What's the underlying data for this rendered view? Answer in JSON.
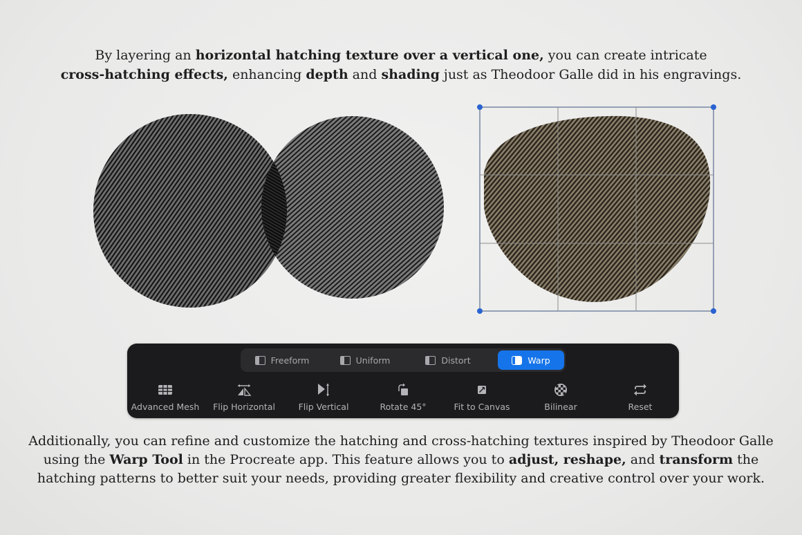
{
  "intro": {
    "line1": [
      {
        "text": "By layering an ",
        "bold": false
      },
      {
        "text": "horizontal hatching texture over a vertical one,",
        "bold": true
      },
      {
        "text": " you can create intricate",
        "bold": false
      }
    ],
    "line2": [
      {
        "text": "cross-hatching effects,",
        "bold": true
      },
      {
        "text": " enhancing ",
        "bold": false
      },
      {
        "text": "depth",
        "bold": true
      },
      {
        "text": " and ",
        "bold": false
      },
      {
        "text": "shading",
        "bold": true
      },
      {
        "text": " just as Theodoor Galle did in his engravings.",
        "bold": false
      }
    ]
  },
  "segment_tabs": [
    {
      "label": "Freeform",
      "active": false
    },
    {
      "label": "Uniform",
      "active": false
    },
    {
      "label": "Distort",
      "active": false
    },
    {
      "label": "Warp",
      "active": true
    }
  ],
  "tools": [
    {
      "label": "Advanced Mesh",
      "icon": "grid-mesh-icon"
    },
    {
      "label": "Flip Horizontal",
      "icon": "flip-horizontal-icon"
    },
    {
      "label": "Flip Vertical",
      "icon": "flip-vertical-icon"
    },
    {
      "label": "Rotate 45°",
      "icon": "rotate-icon"
    },
    {
      "label": "Fit to Canvas",
      "icon": "fit-to-canvas-icon"
    },
    {
      "label": "Bilinear",
      "icon": "bilinear-checker-icon"
    },
    {
      "label": "Reset",
      "icon": "reset-arrows-icon"
    }
  ],
  "outro": {
    "line1": [
      {
        "text": "Additionally, you can refine and customize the hatching and cross-hatching textures inspired by Theodoor Galle",
        "bold": false
      }
    ],
    "line2": [
      {
        "text": "using the ",
        "bold": false
      },
      {
        "text": "Warp Tool",
        "bold": true
      },
      {
        "text": " in the Procreate app. This feature allows you to ",
        "bold": false
      },
      {
        "text": "adjust, reshape,",
        "bold": true
      },
      {
        "text": " and ",
        "bold": false
      },
      {
        "text": "transform",
        "bold": true
      },
      {
        "text": " the",
        "bold": false
      }
    ],
    "line3": [
      {
        "text": "hatching patterns to better suit your needs, providing greater flexibility and creative control over your work.",
        "bold": false
      }
    ]
  },
  "colors": {
    "accent": "#1674ea",
    "toolbar_bg": "#1b1b1d",
    "handle": "#2a63d0",
    "ink": "#1e1e1e"
  }
}
